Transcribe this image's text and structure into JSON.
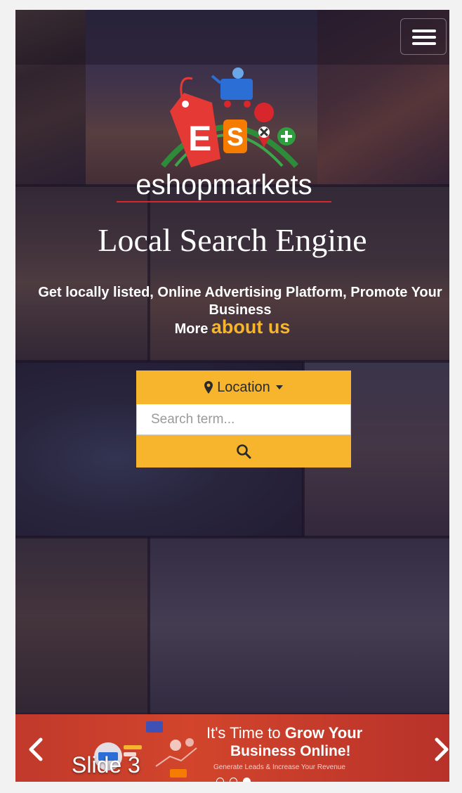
{
  "header": {
    "brand": "eshopmarkets",
    "logo_letters": [
      "E",
      "S"
    ],
    "menu_icon": "hamburger-menu-icon"
  },
  "hero": {
    "title": "Local Search Engine",
    "tagline": "Get locally listed, Online Advertising Platform, Promote Your Business",
    "more_prefix": "More",
    "about_link": "about us",
    "accent_color": "#f6b52c"
  },
  "search": {
    "location_label": "Location",
    "location_icon": "map-marker-icon",
    "placeholder": "Search term...",
    "value": "",
    "submit_icon": "search-icon"
  },
  "carousel": {
    "caption": "Slide 3",
    "banner_line1_pre": "It's Time to",
    "banner_line1_bold": "Grow Your",
    "banner_line2": "Business Online!",
    "banner_line3": "Generate Leads & Increase Your Revenue",
    "prev_icon": "chevron-left-icon",
    "next_icon": "chevron-right-icon",
    "active_slide": 3,
    "slide_count": 3
  }
}
